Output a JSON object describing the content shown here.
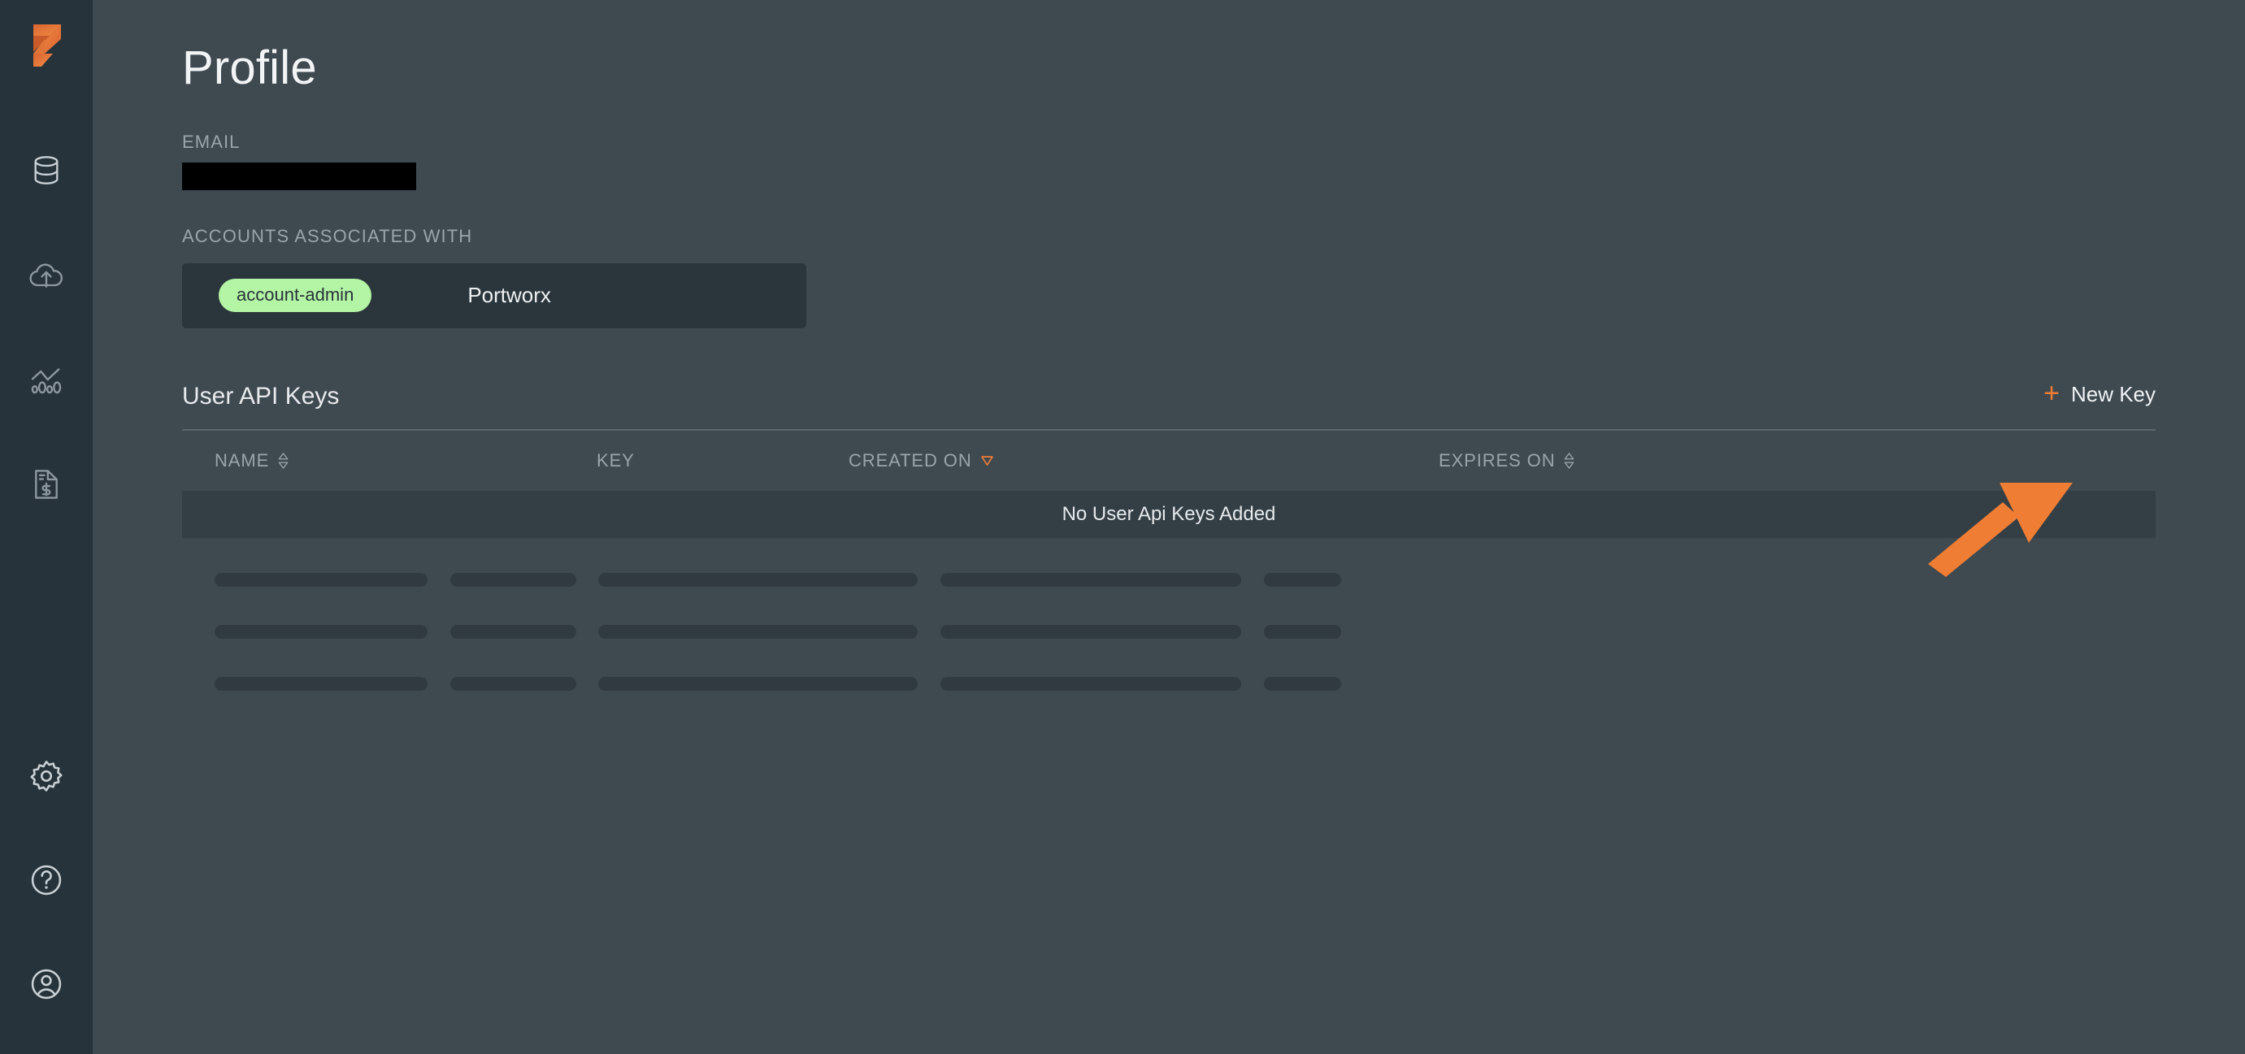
{
  "app": {
    "logo": "portworx-logo",
    "bg_color": "#3e4950",
    "sidebar_color": "#27333a",
    "accent_color": "#ef7d34"
  },
  "sidebar": {
    "top_items": [
      {
        "name": "database-icon",
        "label": "Clusters"
      },
      {
        "name": "cloud-upload-icon",
        "label": "Backups"
      },
      {
        "name": "chart-metrics-icon",
        "label": "Metrics"
      },
      {
        "name": "invoice-dollar-icon",
        "label": "Billing"
      }
    ],
    "bottom_items": [
      {
        "name": "gear-icon",
        "label": "Settings"
      },
      {
        "name": "help-circle-icon",
        "label": "Help"
      },
      {
        "name": "user-circle-icon",
        "label": "Account"
      }
    ]
  },
  "main": {
    "page_title": "Profile",
    "email": {
      "label": "EMAIL",
      "value": "",
      "redacted": true
    },
    "accounts": {
      "label": "ACCOUNTS ASSOCIATED WITH",
      "rows": [
        {
          "role": "account-admin",
          "name": "Portworx"
        }
      ],
      "badge_bg": "#b3f5a4",
      "badge_fg": "#27333a"
    },
    "api_keys": {
      "title": "User API Keys",
      "new_key_button": {
        "icon": "plus-icon",
        "label": "New Key"
      },
      "columns": [
        {
          "label": "NAME",
          "sort": "none",
          "sort_icon": "sort-both-icon"
        },
        {
          "label": "KEY",
          "sort": null,
          "sort_icon": null
        },
        {
          "label": "CREATED ON",
          "sort": "desc",
          "sort_icon": "sort-desc-icon"
        },
        {
          "label": "EXPIRES ON",
          "sort": "none",
          "sort_icon": "sort-both-icon"
        }
      ],
      "rows": [],
      "empty_message": "No User Api Keys Added",
      "skeleton_row_count": 3
    }
  },
  "annotation": {
    "arrow": {
      "name": "orange-pointer-arrow",
      "color": "#ef7d34",
      "points_to": "New Key"
    }
  }
}
